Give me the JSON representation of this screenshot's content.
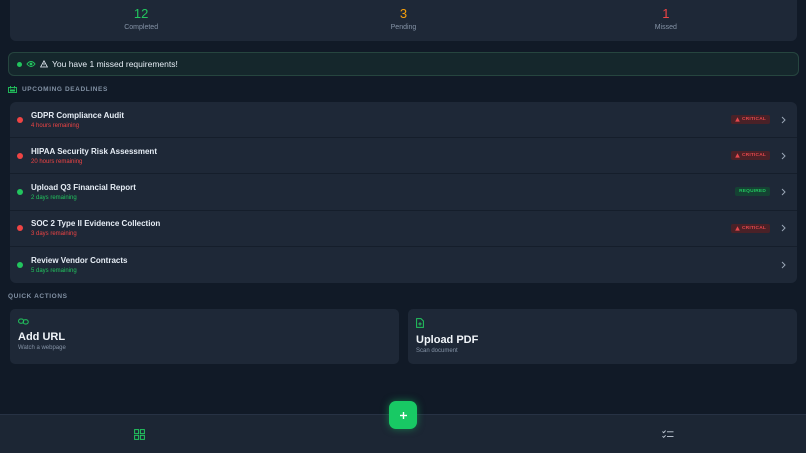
{
  "stats": [
    {
      "value": "12",
      "label": "Completed",
      "color": "#22c55e"
    },
    {
      "value": "3",
      "label": "Pending",
      "color": "#f59e0b"
    },
    {
      "value": "1",
      "label": "Missed",
      "color": "#ef4444"
    }
  ],
  "alert": {
    "text": "You have 1 missed requirements!"
  },
  "sections": {
    "deadlines": "UPCOMING DEADLINES",
    "quick_actions": "QUICK ACTIONS"
  },
  "deadlines": [
    {
      "title": "GDPR Compliance Audit",
      "subtitle": "4 hours remaining",
      "status": "critical",
      "badge": "CRITICAL"
    },
    {
      "title": "HIPAA Security Risk Assessment",
      "subtitle": "20 hours remaining",
      "status": "critical",
      "badge": "CRITICAL"
    },
    {
      "title": "Upload Q3 Financial Report",
      "subtitle": "2 days remaining",
      "status": "ok",
      "badge": "REQUIRED"
    },
    {
      "title": "SOC 2 Type II Evidence Collection",
      "subtitle": "3 days remaining",
      "status": "critical",
      "badge": "CRITICAL"
    },
    {
      "title": "Review Vendor Contracts",
      "subtitle": "5 days remaining",
      "status": "ok",
      "badge": ""
    }
  ],
  "quick_actions": [
    {
      "title": "Add URL",
      "subtitle": "Watch a webpage",
      "icon": "link-icon"
    },
    {
      "title": "Upload PDF",
      "subtitle": "Scan document",
      "icon": "file-plus-icon"
    }
  ],
  "nav": {
    "left_icon": "dashboard-grid-icon",
    "right_icon": "checklist-icon",
    "fab_icon": "plus-icon"
  },
  "colors": {
    "accent": "#22c55e",
    "critical": "#ef4444",
    "warning": "#f59e0b"
  }
}
